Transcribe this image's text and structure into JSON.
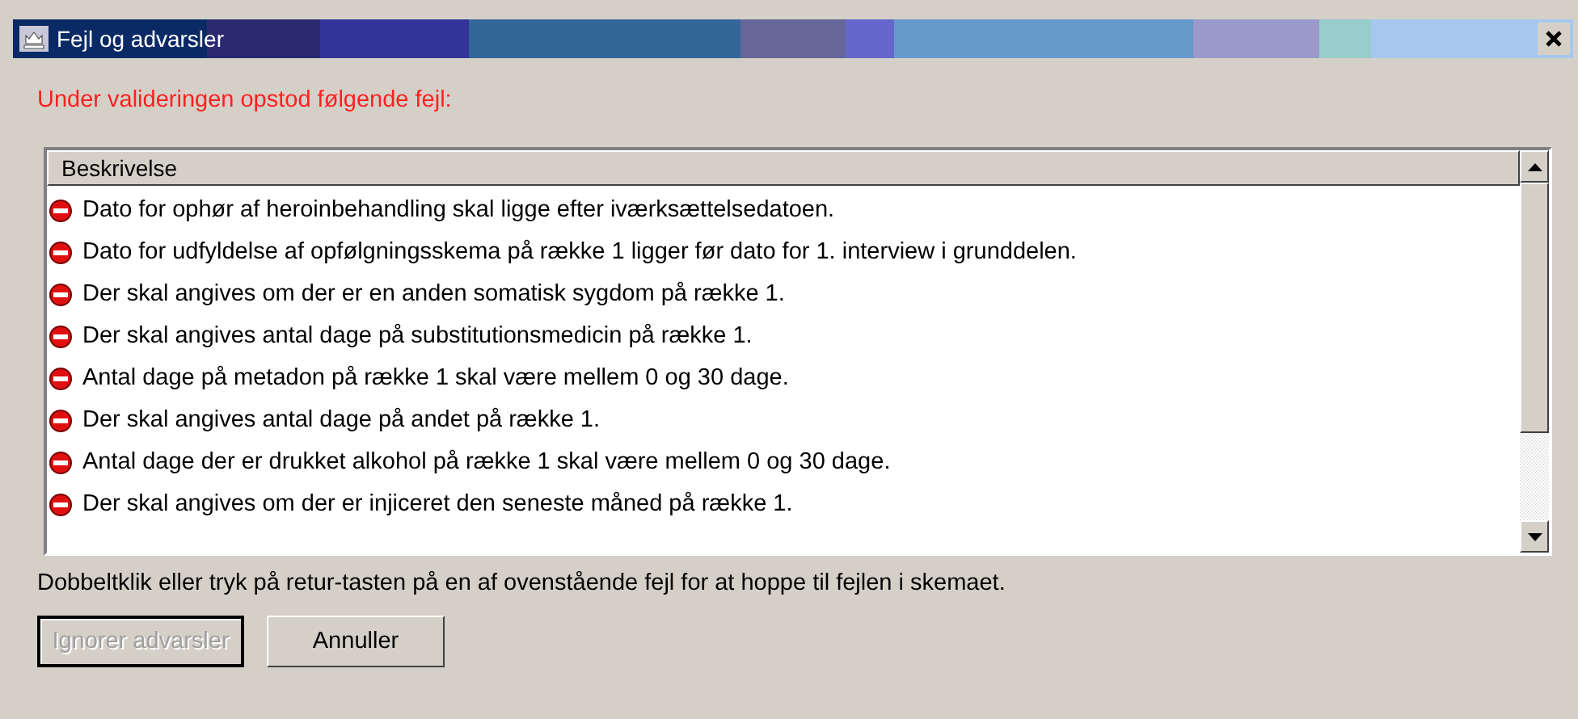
{
  "window": {
    "title": "Fejl og advarsler"
  },
  "heading": "Under valideringen opstod følgende fejl:",
  "list": {
    "column": "Beskrivelse",
    "rows": [
      {
        "text": "Dato for ophør af heroinbehandling skal ligge efter iværksættelsedatoen."
      },
      {
        "text": "Dato for udfyldelse af opfølgningsskema på række 1 ligger før dato for 1. interview i grunddelen."
      },
      {
        "text": "Der skal angives om der er en anden somatisk sygdom på række 1."
      },
      {
        "text": "Der skal angives antal dage på substitutionsmedicin på række 1."
      },
      {
        "text": "Antal dage på metadon på række 1 skal være mellem 0 og 30 dage."
      },
      {
        "text": "Der skal angives antal dage på andet på række 1."
      },
      {
        "text": "Antal dage der er drukket alkohol på række 1 skal være mellem 0 og 30 dage."
      },
      {
        "text": "Der skal angives om der er injiceret den seneste måned på række 1."
      }
    ]
  },
  "hint": "Dobbeltklik eller tryk på retur-tasten på en af ovenstående fejl for at hoppe til fejlen i skemaet.",
  "buttons": [
    {
      "label": "Ignorer advarsler",
      "disabled": true
    },
    {
      "label": "Annuller",
      "disabled": false
    }
  ]
}
